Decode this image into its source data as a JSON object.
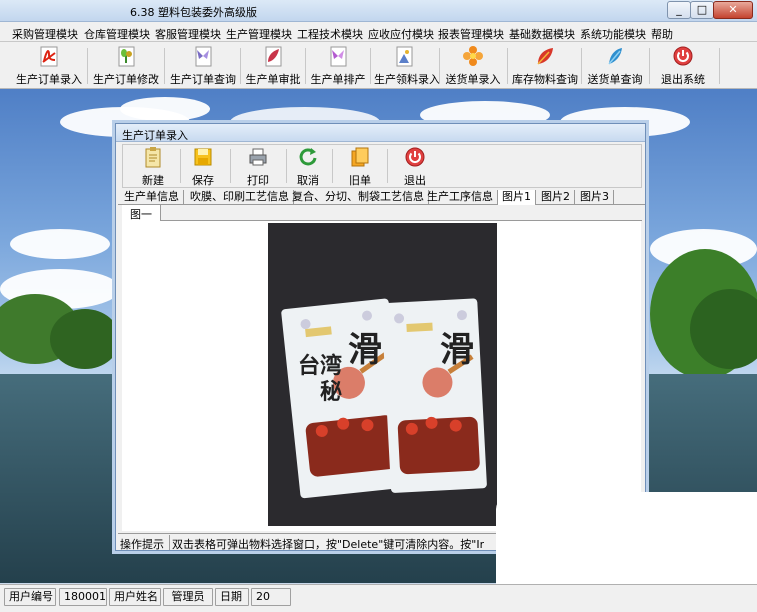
{
  "window": {
    "title": "6.38 塑料包装委外高级版",
    "controls": {
      "minimize": "_",
      "maximize": "□",
      "close": "✕"
    }
  },
  "menu": [
    "采购管理模块",
    "仓库管理模块",
    "客服管理模块",
    "生产管理模块",
    "工程技术模块",
    "应收应付模块",
    "报表管理模块",
    "基础数据模块",
    "系统功能模块",
    "帮助"
  ],
  "toolbar": {
    "buttons": [
      {
        "label": "生产订单录入",
        "icon": "pdf-document-icon"
      },
      {
        "label": "生产订单修改",
        "icon": "plant-document-icon"
      },
      {
        "label": "生产订单查询",
        "icon": "butterfly-document-icon"
      },
      {
        "label": "生产单审批",
        "icon": "leaf-document-icon"
      },
      {
        "label": "生产单排产",
        "icon": "butterfly-document-icon"
      },
      {
        "label": "生产领料录入",
        "icon": "image-document-icon"
      },
      {
        "label": "送货单录入",
        "icon": "flower-icon"
      },
      {
        "label": "库存物料查询",
        "icon": "red-leaf-icon"
      },
      {
        "label": "送货单查询",
        "icon": "feather-icon"
      },
      {
        "label": "退出系统",
        "icon": "exit-icon"
      }
    ]
  },
  "child": {
    "title": "生产订单录入",
    "toolbar": [
      {
        "label": "新建",
        "icon": "clipboard-icon"
      },
      {
        "label": "保存",
        "icon": "floppy-disk-icon"
      },
      {
        "label": "打印",
        "icon": "printer-icon"
      },
      {
        "label": "取消",
        "icon": "cancel-arrow-icon"
      },
      {
        "label": "旧单",
        "icon": "old-documents-icon"
      },
      {
        "label": "退出",
        "icon": "exit-icon"
      }
    ],
    "tabs": [
      "生产单信息",
      "吹膜、印刷工艺信息",
      "复合、分切、制袋工艺信息",
      "生产工序信息",
      "图片1",
      "图片2",
      "图片3"
    ],
    "active_tab_index": 4,
    "subtab": "图一",
    "photo_product_text": [
      "台湾",
      "秘",
      "滑"
    ],
    "hint_label": "操作提示",
    "hint_text": "双击表格可弹出物料选择窗口，按\"Delete\"键可清除内容。按\"Insert\"键"
  },
  "status": {
    "user_id_label": "用户编号",
    "user_id": "180001",
    "user_name_label": "用户姓名",
    "user_name": "管理员",
    "date_label": "日期",
    "date_value": "20"
  }
}
